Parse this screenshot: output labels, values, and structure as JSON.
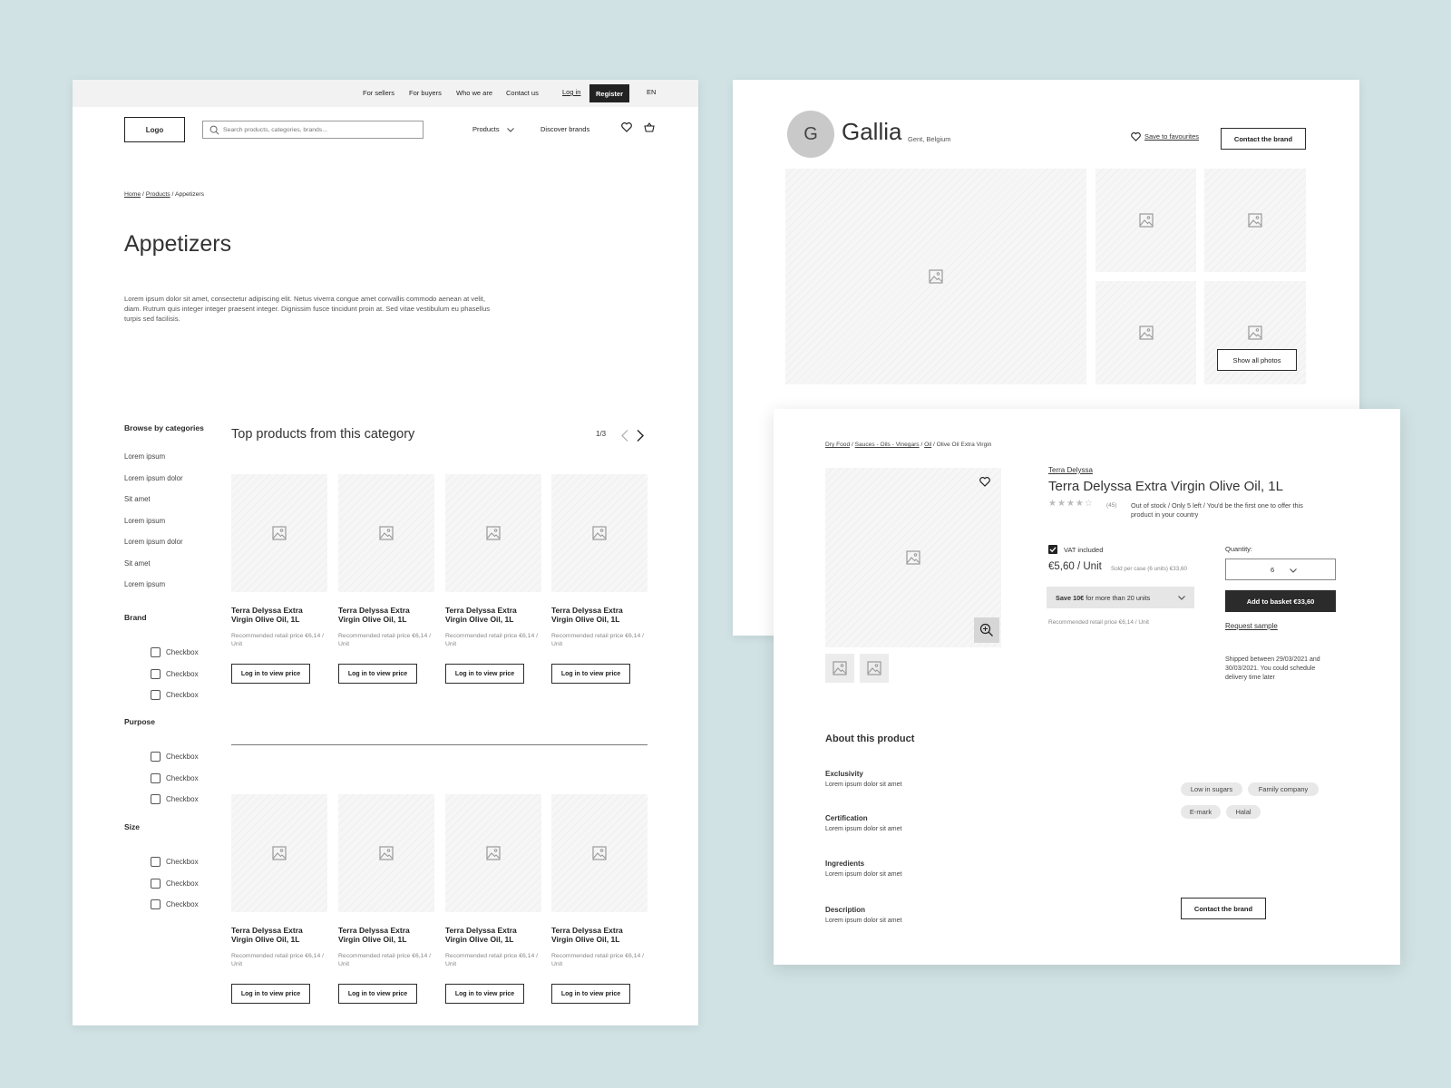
{
  "left": {
    "topbar": {
      "links": [
        "For sellers",
        "For buyers",
        "Who we are",
        "Contact us"
      ],
      "login": "Log in",
      "register": "Register",
      "lang": "EN"
    },
    "header": {
      "logo": "Logo",
      "search_placeholder": "Search products, categories, brands...",
      "products": "Products",
      "discover": "Discover brands"
    },
    "breadcrumb": {
      "home": "Home",
      "sep1": " / ",
      "products": "Products",
      "sep2": " / ",
      "current": "Appetizers"
    },
    "title": "Appetizers",
    "description": "Lorem ipsum dolor sit amet, consectetur adipiscing elit. Netus viverra congue amet convallis commodo aenean at velit, diam. Rutrum quis integer integer praesent integer. Dignissim fusce tincidunt proin at. Sed vitae vestibulum eu phasellus turpis sed facilisis.",
    "sidebar": {
      "browse_title": "Browse by categories",
      "categories": [
        "Lorem ipsum",
        "Lorem ipsum dolor",
        "Sit amet",
        "Lorem ipsum",
        "Lorem ipsum dolor",
        "Sit amet",
        "Lorem ipsum"
      ],
      "filters": [
        {
          "title": "Brand",
          "options": [
            "Checkbox",
            "Checkbox",
            "Checkbox"
          ]
        },
        {
          "title": "Purpose",
          "options": [
            "Checkbox",
            "Checkbox",
            "Checkbox"
          ]
        },
        {
          "title": "Size",
          "options": [
            "Checkbox",
            "Checkbox",
            "Checkbox"
          ]
        }
      ]
    },
    "section_title": "Top products from this category",
    "pager": "1/3",
    "product_name": "Terra Delyssa Extra Virgin Olive Oil, 1L",
    "product_rrp": "Recommended retail price €6,14 / Unit",
    "product_button": "Log in to view price"
  },
  "brand": {
    "avatar": "G",
    "name": "Gallia",
    "location": "Gent, Belgium",
    "save": "Save to favourites",
    "contact": "Contact the brand",
    "show_all": "Show all photos"
  },
  "detail": {
    "breadcrumb": {
      "c1": "Dry Food",
      "sep": " / ",
      "c2": "Sauces - Oils - Vinegars",
      "c3": "Oil",
      "current": "Olive Oil Extra Virgin"
    },
    "brand": "Terra Delyssa",
    "title": "Terra Delyssa Extra Virgin Olive Oil, 1L",
    "rating": {
      "value": 4,
      "max": 5,
      "count": "(45)"
    },
    "stock": "Out of stock / Only 5 left / You'd be the first one to offer this product in your country",
    "vat": "VAT included",
    "price": "€5,60 / Unit",
    "per_case": "Sold per case (6 units) €33,60",
    "save_bold": "Save 10€",
    "save_rest": "for more than 20 units",
    "rrp": "Recommended retail price €6,14 / Unit",
    "quantity_label": "Quantity:",
    "quantity": "6",
    "add_basket": "Add to basket €33,60",
    "request_sample": "Request sample",
    "shipping": "Shipped between 29/03/2021 and 30/03/2021. You could schedule delivery time later",
    "about_title": "About this product",
    "about": [
      {
        "title": "Exclusivity",
        "text": "Lorem ipsum dolor sit amet"
      },
      {
        "title": "Certification",
        "text": "Lorem ipsum dolor sit amet"
      },
      {
        "title": "Ingredients",
        "text": "Lorem ipsum dolor sit amet"
      },
      {
        "title": "Description",
        "text": "Lorem ipsum dolor sit amet"
      }
    ],
    "tags": [
      "Low in sugars",
      "Family company",
      "E-mark",
      "Halal"
    ],
    "contact": "Contact the brand"
  }
}
